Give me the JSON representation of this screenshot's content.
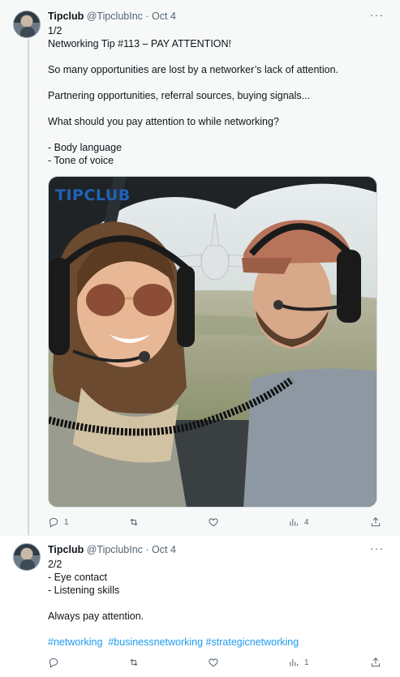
{
  "tweets": [
    {
      "name": "Tipclub",
      "handle": "@TipclubInc",
      "date": "Oct 4",
      "more": "···",
      "lines": [
        "1/2",
        "Networking Tip #113 – PAY ATTENTION!",
        "",
        "So many opportunities are lost by a networker’s lack of attention.",
        "",
        "Partnering opportunities, referral sources, buying signals...",
        "",
        "What should you pay attention to while networking?",
        "",
        "- Body language",
        "- Tone of voice"
      ],
      "media_brand": "TIPCLUB",
      "stats": {
        "replies": "1",
        "retweets": "",
        "likes": "",
        "views": "4"
      }
    },
    {
      "name": "Tipclub",
      "handle": "@TipclubInc",
      "date": "Oct 4",
      "more": "···",
      "lines": [
        "2/2",
        "- Eye contact",
        "- Listening skills",
        "",
        "Always pay attention."
      ],
      "hashtags": "#networking  #businessnetworking #strategicnetworking",
      "stats": {
        "replies": "",
        "retweets": "",
        "likes": "",
        "views": "1"
      }
    }
  ],
  "icons": {
    "reply": "reply-icon",
    "retweet": "retweet-icon",
    "like": "heart-icon",
    "views": "views-icon",
    "share": "share-icon"
  },
  "colors": {
    "link": "#1d9bf0",
    "muted": "#536471",
    "thread_bg": "#f7f9f9",
    "brand_logo": "#1e63b8"
  }
}
